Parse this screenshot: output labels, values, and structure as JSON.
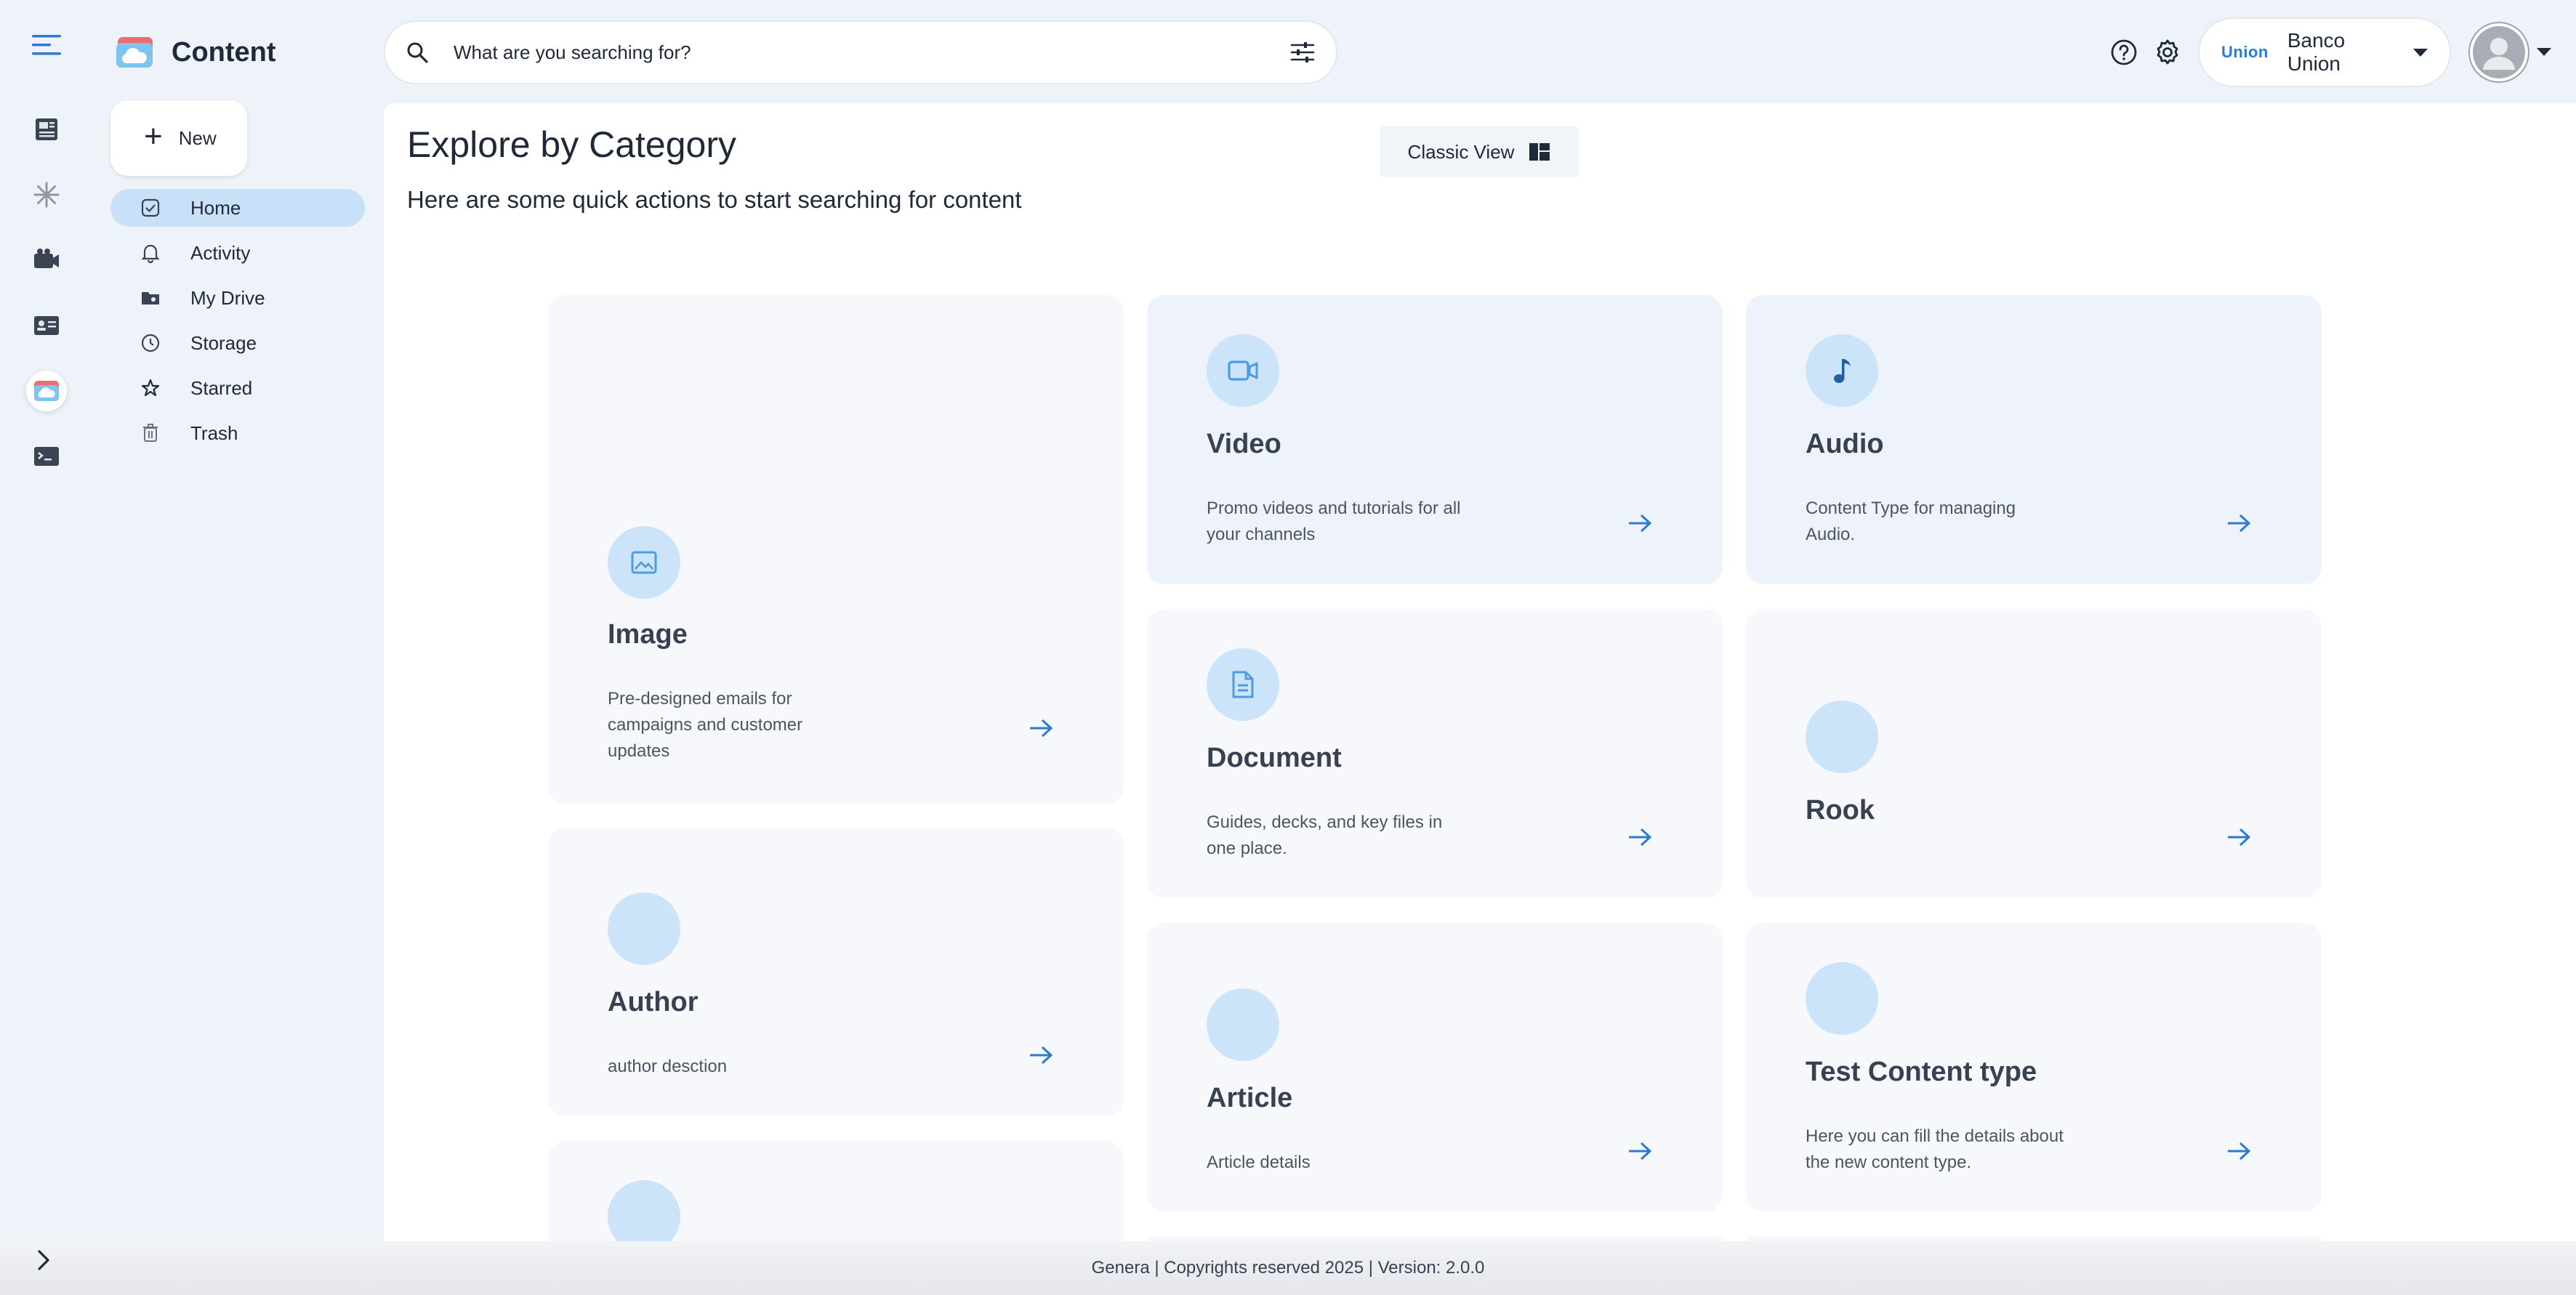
{
  "app": {
    "title": "Content"
  },
  "sidebar": {
    "new_label": "New",
    "items": [
      {
        "label": "Home",
        "icon": "home-check-icon",
        "active": true
      },
      {
        "label": "Activity",
        "icon": "bell-icon",
        "active": false
      },
      {
        "label": "My Drive",
        "icon": "drive-folder-icon",
        "active": false
      },
      {
        "label": "Storage",
        "icon": "clock-icon",
        "active": false
      },
      {
        "label": "Starred",
        "icon": "star-icon",
        "active": false
      },
      {
        "label": "Trash",
        "icon": "trash-icon",
        "active": false
      }
    ]
  },
  "rail": {
    "apps": [
      "newspaper-icon",
      "snowflake-icon",
      "video-camera-icon",
      "id-card-icon",
      "content-cloud-icon",
      "terminal-icon"
    ],
    "active_index": 4
  },
  "search": {
    "placeholder": "What are you searching for?"
  },
  "org": {
    "logo_text": "Union",
    "name": "Banco Union"
  },
  "main": {
    "title": "Explore by Category",
    "subtitle": "Here are some quick actions to start searching for content",
    "classic_view_label": "Classic View",
    "cards": [
      {
        "title": "Image",
        "desc": "Pre-designed emails for campaigns and customer updates",
        "icon": "image-icon"
      },
      {
        "title": "Video",
        "desc": "Promo videos and tutorials for all your channels",
        "icon": "video-icon"
      },
      {
        "title": "Audio",
        "desc": "Content Type for managing Audio.",
        "icon": "music-note-icon"
      },
      {
        "title": "Document",
        "desc": "Guides, decks, and key files in one place.",
        "icon": "document-icon"
      },
      {
        "title": "Rook",
        "desc": "",
        "icon": ""
      },
      {
        "title": "Author",
        "desc": "author desction",
        "icon": ""
      },
      {
        "title": "Article",
        "desc": "Article details",
        "icon": ""
      },
      {
        "title": "Test Content type",
        "desc": "Here you can fill the details about the new content type.",
        "icon": ""
      }
    ]
  },
  "footer": {
    "text": "Genera | Copyrights reserved 2025 | Version: 2.0.0"
  },
  "colors": {
    "accent": "#2b7bd0",
    "active_nav": "#c8e1f8",
    "icon_circle": "#cbe4f9",
    "card_bg": "#f6f8fb",
    "card_tint": "#eef3fb"
  }
}
